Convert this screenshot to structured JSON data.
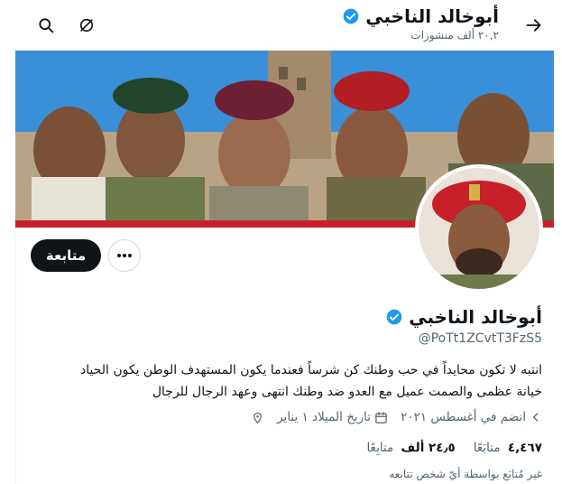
{
  "header": {
    "name": "أبوخالد الناخبي",
    "posts_count": "٢٠,٢ ألف منشورات"
  },
  "profile": {
    "name": "أبوخالد الناخبي",
    "handle": "@PoTt1ZCvtT3FzS5",
    "bio_line1": "انتبه لا تكون محايداً في حب وطنك كن شرساً فعندما يكون المستهدف الوطن يكون الحياد",
    "bio_line2": "خيانة عظمى والصمت عميل مع العدو ضد وطنك انتهى وعهد الرجال للرجال",
    "joined": "انضم في أغسطس ٢٠٢١",
    "birthdate": "تاريخ الميلاد ١ يناير",
    "following_count": "٤,٤٦٧",
    "following_label": "متابَعًا",
    "followers_count": "٢٤٫٥ ألف",
    "followers_label": "متابِعًا",
    "not_followed_text": "غير مُتابَع بواسطة أيّ شخص تتابعه"
  },
  "actions": {
    "follow_label": "متابعة"
  },
  "icons": {
    "back": "arrow-right-icon",
    "search": "search-icon",
    "mute": "notifications-off-icon",
    "more": "more-dots-icon",
    "verified": "verified-badge-icon",
    "calendar": "calendar-icon",
    "location": "birthday-location-icon",
    "chevron": "chevron-left-icon"
  },
  "colors": {
    "verified": "#1d9bf0",
    "follow_bg": "#0f1419",
    "muted_text": "#536471"
  }
}
